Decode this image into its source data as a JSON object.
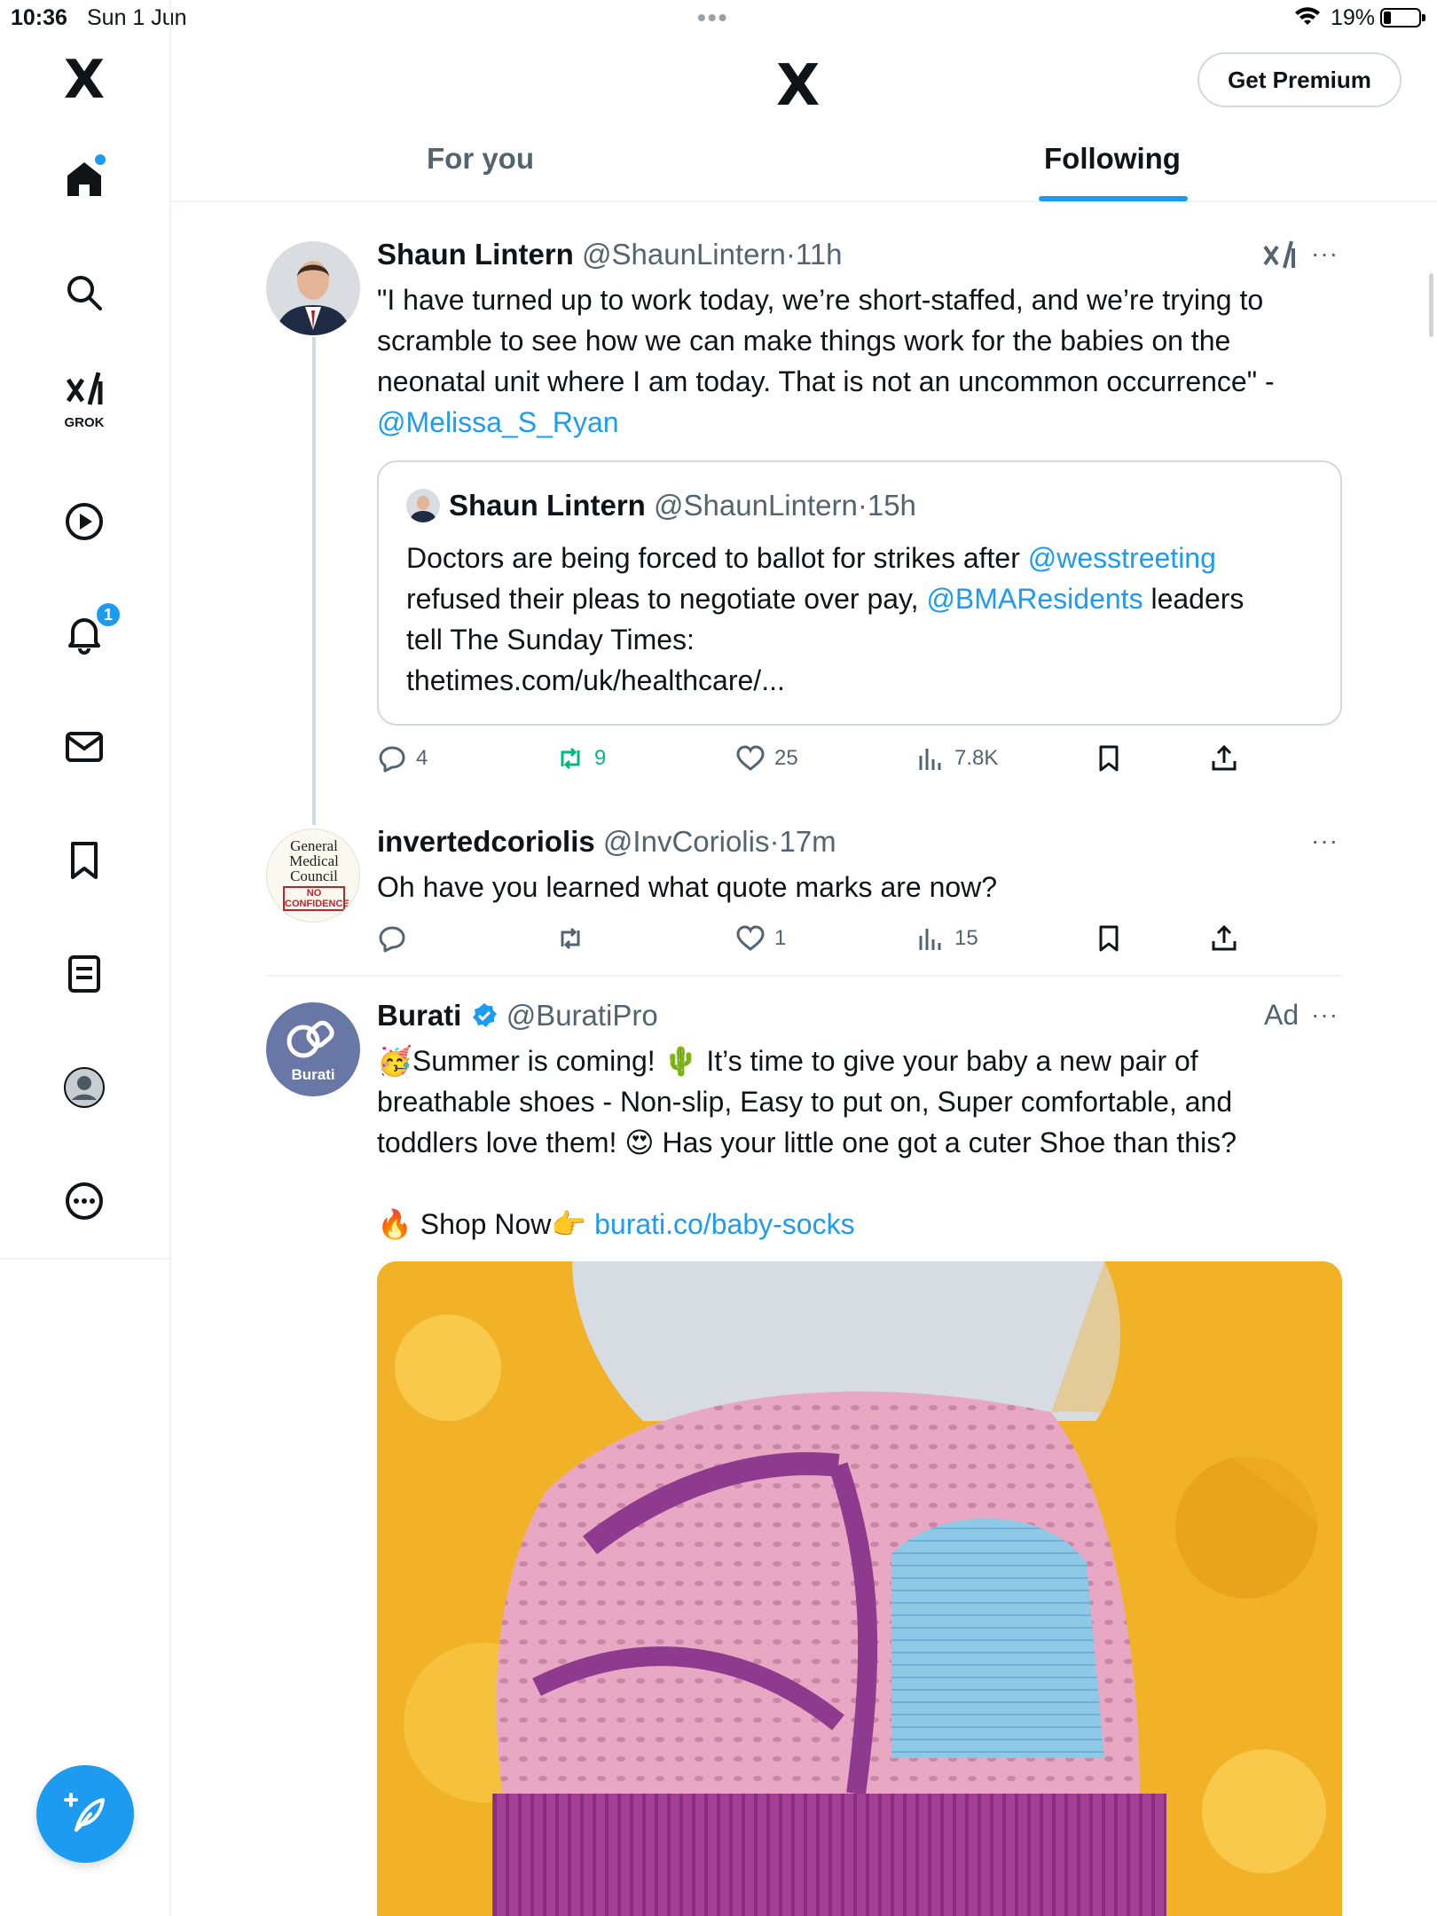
{
  "status_bar": {
    "time": "10:36",
    "date": "Sun 1 Jun",
    "battery_pct": "19%",
    "multitask_dots": "•••"
  },
  "sidebar": {
    "logo": "X",
    "grok_label": "GROK",
    "notifications_count": "1",
    "items": [
      "home-icon",
      "search-icon",
      "grok-icon",
      "video-icon",
      "notifications-icon",
      "messages-icon",
      "bookmarks-icon",
      "lists-icon",
      "profile-icon",
      "more-icon"
    ]
  },
  "header": {
    "logo": "X",
    "premium_button": "Get Premium",
    "tabs": [
      {
        "label": "For you",
        "active": false
      },
      {
        "label": "Following",
        "active": true
      }
    ]
  },
  "tweets": [
    {
      "name": "Shaun Lintern",
      "handle": "@ShaunLintern",
      "time": "11h",
      "text_line1": "\"I have turned up to work today, we’re short-staffed, and we’re trying to",
      "text_line2": "scramble to see how we can make things work for the babies on the",
      "text_line3": "neonatal unit where I am today. That is not an uncommon occurrence\" -",
      "mention": "@Melissa_S_Ryan",
      "quote": {
        "name": "Shaun Lintern",
        "handle": "@ShaunLintern",
        "time": "15h",
        "line1_prefix": "Doctors are being forced to ballot for strikes after ",
        "line1_mention": "@wesstreeting",
        "line2_prefix": "refused their pleas to negotiate over pay, ",
        "line2_mention": "@BMAResidents",
        "line2_suffix": " leaders",
        "line3": "tell The Sunday Times:",
        "line4": "thetimes.com/uk/healthcare/..."
      },
      "stats": {
        "replies": "4",
        "reposts": "9",
        "likes": "25",
        "views": "7.8K"
      },
      "colors": {
        "repost_active": "#00ba7c"
      }
    },
    {
      "name": "invertedcoriolis",
      "handle": "@InvCoriolis",
      "time": "17m",
      "text": "Oh have you learned what quote marks are now?",
      "avatar_text": [
        "General",
        "Medical",
        "Council",
        "NO",
        "CONFIDENCE"
      ],
      "stats": {
        "replies": "",
        "reposts": "",
        "likes": "1",
        "views": "15"
      }
    },
    {
      "name": "Burati",
      "handle": "@BuratiPro",
      "ad_label": "Ad",
      "verified": true,
      "avatar_text": "Burati",
      "line1": "🥳Summer is coming! 🌵 It’s time to give your baby a new pair of",
      "line2": "breathable shoes - Non-slip, Easy to put on, Super comfortable, and",
      "line3": "toddlers love them! 😍 Has your little one got a cuter Shoe than this?",
      "shop_prefix": "🔥 Shop Now👉 ",
      "shop_link": "burati.co/baby-socks"
    }
  ],
  "colors": {
    "accent": "#1d9bf0",
    "text": "#0f1419",
    "muted": "#536471",
    "border": "#eff3f4"
  }
}
